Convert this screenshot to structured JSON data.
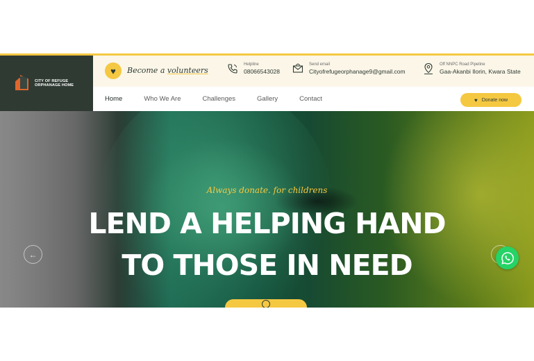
{
  "logo": {
    "text": "CITY OF REFUGE ORPHANAGE HOME"
  },
  "info_bar": {
    "volunteer_label": "Become a volunteers",
    "helpline": {
      "label": "Helpline",
      "value": "08066543028",
      "icon": "phone-icon"
    },
    "email": {
      "label": "Send email",
      "value": "Cityofrefugeorphanage9@gmail.com",
      "icon": "mail-icon"
    },
    "address": {
      "label": "Off NNPC Road Pipeline",
      "value": "Gaa-Akanbi Ilorin, Kwara State",
      "icon": "map-pin-icon"
    }
  },
  "nav": {
    "items": [
      "Home",
      "Who We Are",
      "Challenges",
      "Gallery",
      "Contact"
    ],
    "active": "Home",
    "donate_label": "Donate now"
  },
  "hero": {
    "tagline": "Always donate. for childrens",
    "title_line1": "LEND A HELPING HAND",
    "title_line2": "TO THOSE IN NEED"
  },
  "colors": {
    "accent": "#f5c842",
    "dark": "#2f3a33",
    "whatsapp": "#25d366"
  }
}
